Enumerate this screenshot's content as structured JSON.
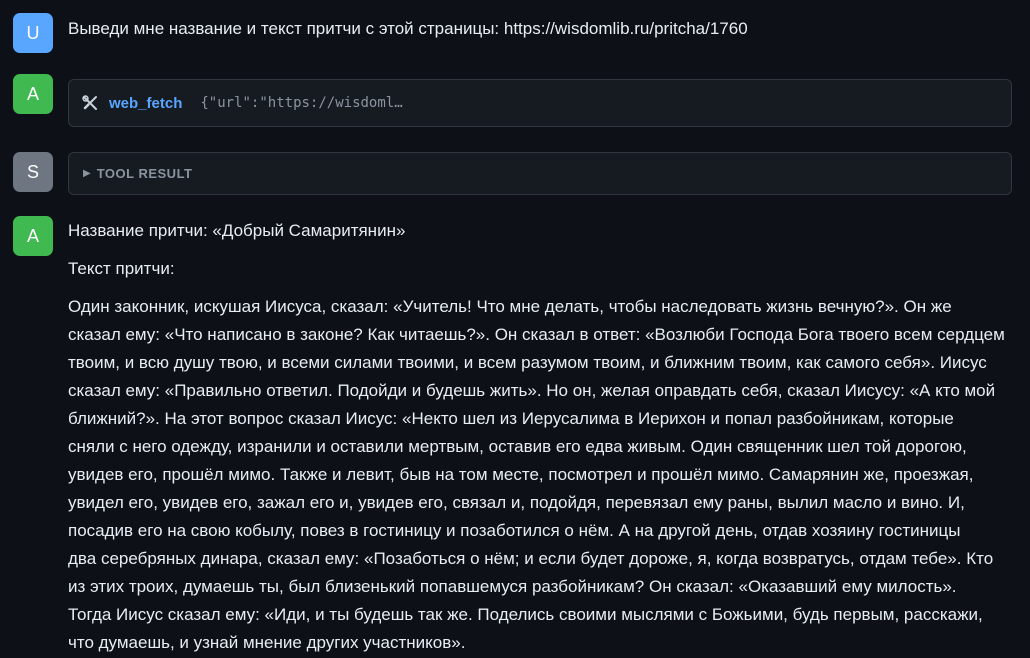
{
  "messages": [
    {
      "role_badge": "U",
      "text": "Выведи мне название и текст притчи с этой страницы: https://wisdomlib.ru/pritcha/1760"
    },
    {
      "role_badge": "A",
      "tool_call": {
        "icon": "tools-icon",
        "name": "web_fetch",
        "args": "{\"url\":\"https://wisdoml…"
      }
    },
    {
      "role_badge": "S",
      "tool_result": {
        "label": "TOOL RESULT",
        "state": "collapsed"
      }
    },
    {
      "role_badge": "A",
      "title_line": "Название притчи: «Добрый Самаритянин»",
      "text_heading": "Текст притчи:",
      "body_lines": [
        "Один законник, искушая Иисуса, сказал: «Учитель! Что мне делать, чтобы наследовать жизнь вечную?». Он же",
        "сказал ему: «Что написано в законе? Как читаешь?». Он сказал в ответ: «Возлюби Господа Бога твоего всем сердцем",
        "твоим, и всю душу твою, и всеми силами твоими, и всем разумом твоим, и ближним твоим, как самого себя». Иисус",
        "сказал ему: «Правильно ответил. Подойди и будешь жить». Но он, желая оправдать себя, сказал Иисусу: «А кто мой",
        "ближний?». На этот вопрос сказал Иисус: «Некто шел из Иерусалима в Иерихон и попал разбойникам, которые",
        "сняли с него одежду, изранили и оставили мертвым, оставив его едва живым. Один священник шел той дорогою,",
        "увидев его, прошёл мимо. Также и левит, быв на том месте, посмотрел и прошёл мимо. Самарянин же, проезжая,",
        "увидел его, увидев его, зажал его и, увидев его, связал и, подойдя, перевязал ему раны, вылил масло и вино. И,",
        "посадив его на свою кобылу, повез в гостиницу и позаботился о нём. А на другой день, отдав хозяину гостиницы",
        "два серебряных динара, сказал ему: «Позаботься о нём; и если будет дороже, я, когда возвратусь, отдам тебе». Кто",
        "из этих троих, думаешь ты, был близенький попавшемуся разбойникам? Он сказал: «Оказавший ему милость».",
        "Тогда Иисус сказал ему: «Иди, и ты будешь так же. Поделись своими мыслями с Божьими, будь первым, расскажи,",
        "что думаешь, и узнай мнение других участников»."
      ]
    }
  ],
  "colors": {
    "background": "#0d1117",
    "user_avatar": "#58a6ff",
    "assistant_avatar": "#3fb950",
    "system_avatar": "#6e7681",
    "tool_name": "#58a6ff",
    "panel": "#161b22"
  }
}
